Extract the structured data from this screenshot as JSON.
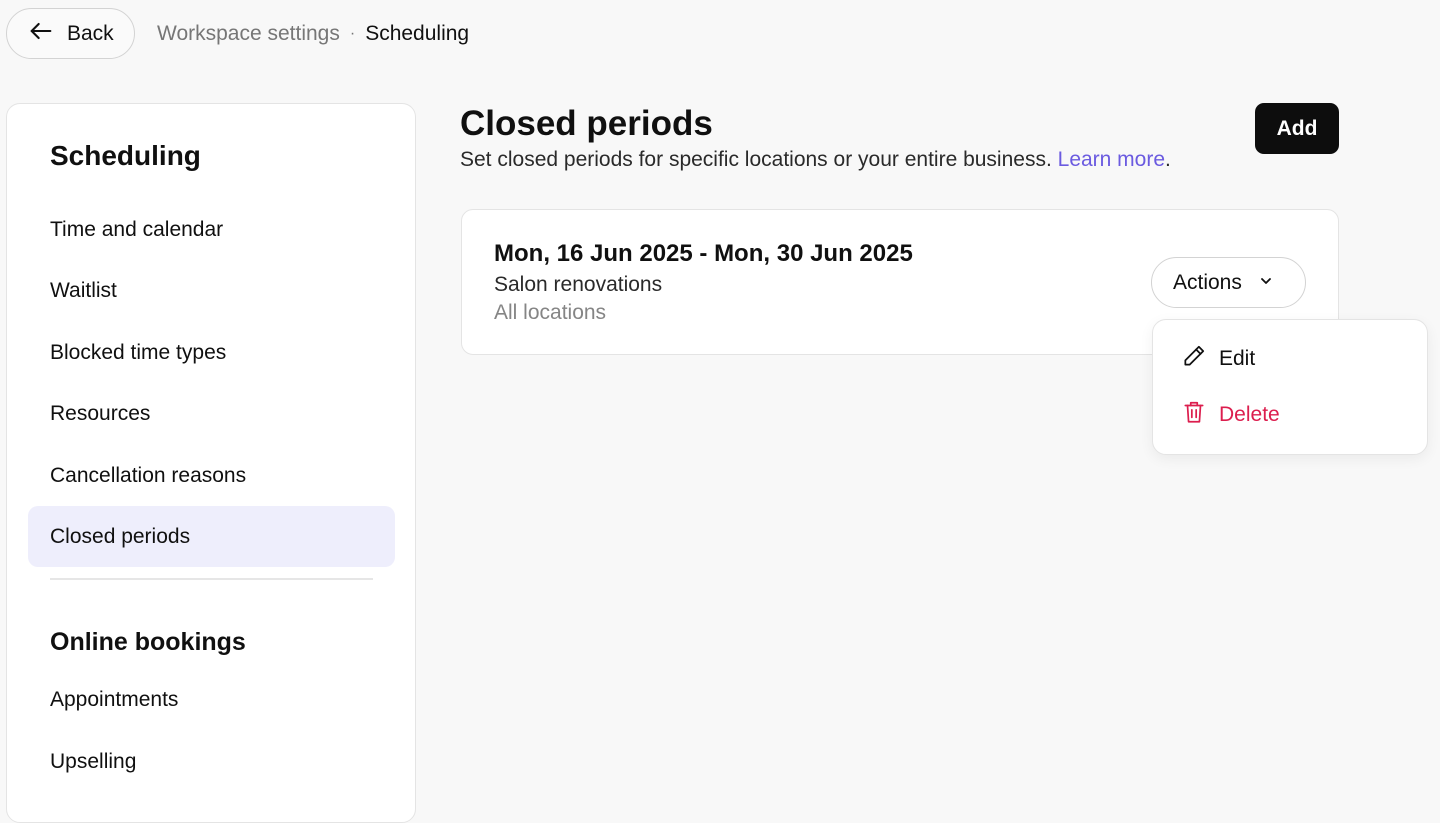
{
  "topbar": {
    "back_label": "Back",
    "breadcrumb": {
      "parent": "Workspace settings",
      "separator": "·",
      "current": "Scheduling"
    }
  },
  "sidebar": {
    "section_title": "Scheduling",
    "items": [
      {
        "label": "Time and calendar",
        "active": false
      },
      {
        "label": "Waitlist",
        "active": false
      },
      {
        "label": "Blocked time types",
        "active": false
      },
      {
        "label": "Resources",
        "active": false
      },
      {
        "label": "Cancellation reasons",
        "active": false
      },
      {
        "label": "Closed periods",
        "active": true
      }
    ],
    "section2_title": "Online bookings",
    "items2": [
      {
        "label": "Appointments"
      },
      {
        "label": "Upselling"
      }
    ]
  },
  "main": {
    "title": "Closed periods",
    "description": "Set closed periods for specific locations or your entire business.",
    "learn_more": "Learn more",
    "description_end": ".",
    "add_label": "Add",
    "periods": [
      {
        "dates": "Mon, 16 Jun 2025 - Mon, 30 Jun 2025",
        "name": "Salon renovations",
        "locations": "All locations",
        "actions_label": "Actions"
      }
    ]
  },
  "dropdown": {
    "edit_label": "Edit",
    "delete_label": "Delete"
  },
  "colors": {
    "accent_link": "#6b5be0",
    "active_bg": "#eeeefc",
    "danger": "#dc1e4e",
    "primary_button": "#0d0d0d"
  }
}
